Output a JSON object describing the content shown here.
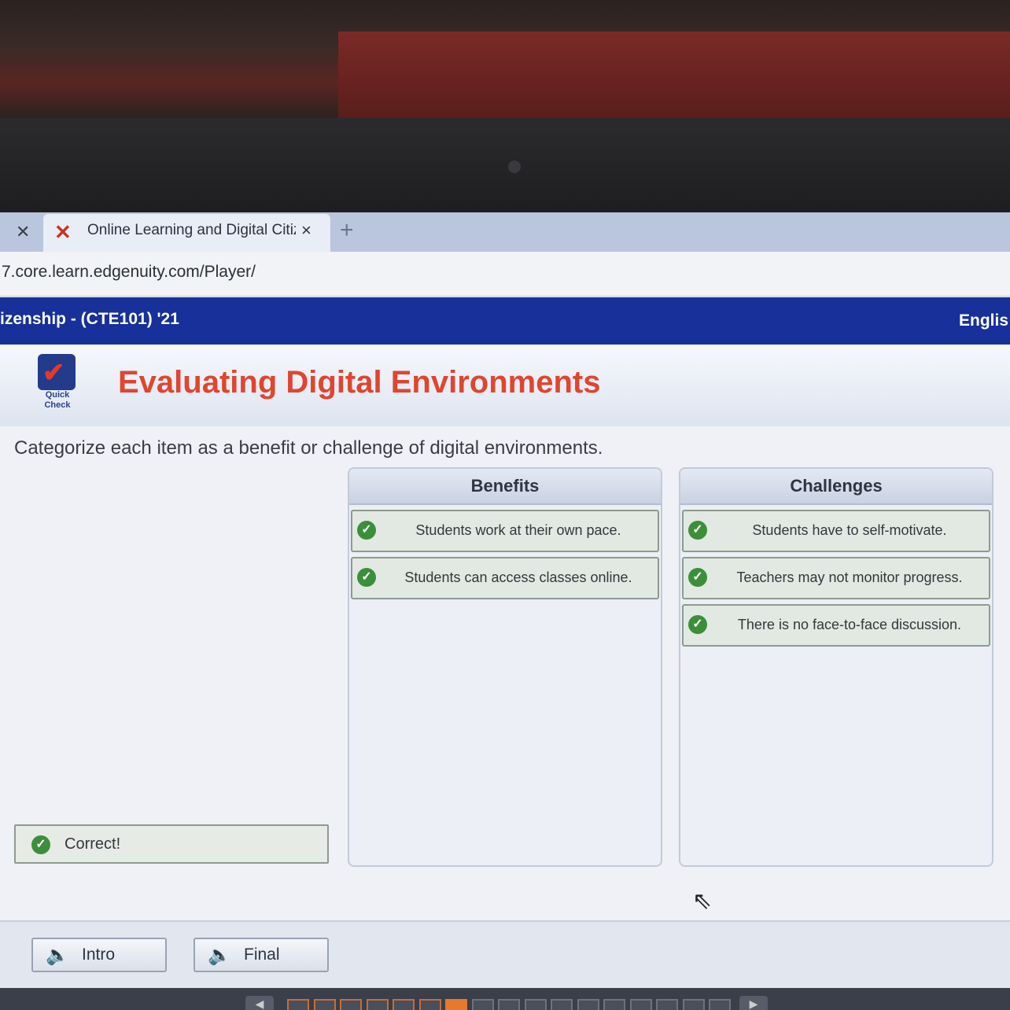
{
  "browser": {
    "tab_title": "Online Learning and Digital Citiz",
    "tab_close_glyph": "×",
    "new_tab_glyph": "+",
    "address": "7.core.learn.edgenuity.com/Player/"
  },
  "course_header": {
    "title": "izenship - (CTE101) '21",
    "language": "Englis"
  },
  "lesson": {
    "badge_label_line1": "Quick",
    "badge_label_line2": "Check",
    "title": "Evaluating Digital Environments"
  },
  "activity": {
    "instruction": "Categorize each item as a benefit or challenge of digital environments.",
    "columns": [
      {
        "heading": "Benefits",
        "items": [
          "Students work at their own pace.",
          "Students can access classes online."
        ]
      },
      {
        "heading": "Challenges",
        "items": [
          "Students have to self-motivate.",
          "Teachers may not monitor progress.",
          "There is no face-to-face discussion."
        ]
      }
    ],
    "feedback": "Correct!"
  },
  "toolbar": {
    "intro_label": "Intro",
    "final_label": "Final"
  },
  "progress": {
    "completed_pages": 6,
    "current_page": 7,
    "total_pages": 17
  },
  "icons": {
    "favicon": "edgenuity-x-icon",
    "check": "checkmark-icon",
    "speaker": "speaker-icon"
  },
  "colors": {
    "course_bar": "#17309a",
    "lesson_title": "#e0452f",
    "correct_green": "#3c8f3a",
    "progress_current": "#e6782f"
  }
}
